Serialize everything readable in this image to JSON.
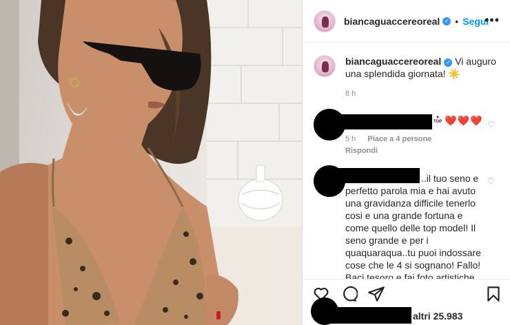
{
  "post": {
    "username": "biancaguaccereoreal",
    "follow_label": "Segui",
    "more_icon": "more-horizontal-icon"
  },
  "caption": {
    "username": "biancaguaccereoreal",
    "text": "Vi auguro una splendida giornata! ☀️",
    "time": "8 h"
  },
  "comments": [
    {
      "text": "❤️❤️❤️",
      "top_badge": "TOP",
      "time": "5 h",
      "likes": "Piace a 4 persone",
      "reply": "Rispondi"
    },
    {
      "text": "..il tuo seno e perfetto parola mia e hai avuto una gravidanza difficile tenerlo cosi e una grande fortuna e come quello delle top model! Il seno grande e per i quaquaraqua..tu puoi indossare cose che le 4 si sognano! Fallo! Baci tesoro e fai foto artistiche"
    }
  ],
  "likes_summary": "altri 25.983",
  "colors": {
    "accent": "#0095f6",
    "verified": "#3897f0",
    "heart": "#ed1c24",
    "muted": "#8e8e8e"
  }
}
